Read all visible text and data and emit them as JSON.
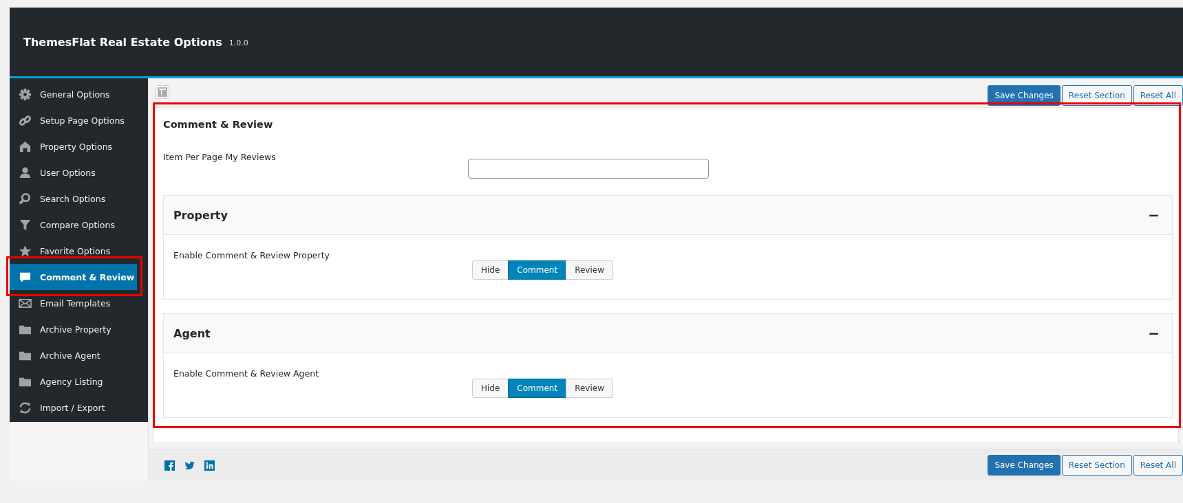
{
  "header": {
    "title": "ThemesFlat Real Estate Options",
    "version": "1.0.0"
  },
  "sidebar": {
    "items": [
      {
        "label": "General Options",
        "selected": false
      },
      {
        "label": "Setup Page Options",
        "selected": false
      },
      {
        "label": "Property Options",
        "selected": false
      },
      {
        "label": "User Options",
        "selected": false
      },
      {
        "label": "Search Options",
        "selected": false
      },
      {
        "label": "Compare Options",
        "selected": false
      },
      {
        "label": "Favorite Options",
        "selected": false
      },
      {
        "label": "Comment & Review",
        "selected": true
      },
      {
        "label": "Email Templates",
        "selected": false
      },
      {
        "label": "Archive Property",
        "selected": false
      },
      {
        "label": "Archive Agent",
        "selected": false
      },
      {
        "label": "Agency Listing",
        "selected": false
      },
      {
        "label": "Import / Export",
        "selected": false
      }
    ]
  },
  "toolbar": {
    "buttons": [
      {
        "label": "Save Changes",
        "kind": "primary"
      },
      {
        "label": "Reset Section",
        "kind": "secondary"
      },
      {
        "label": "Reset All",
        "kind": "secondary"
      }
    ]
  },
  "content": {
    "title": "Comment & Review",
    "field": {
      "label": "Item Per Page My Reviews"
    },
    "sections": [
      {
        "title": "Property",
        "collapse": "−",
        "label": "Enable Comment & Review Property",
        "options": [
          {
            "label": "Hide",
            "selected": false
          },
          {
            "label": "Comment",
            "selected": true
          },
          {
            "label": "Review",
            "selected": false
          }
        ]
      },
      {
        "title": "Agent",
        "collapse": "−",
        "label": "Enable Comment & Review Agent",
        "options": [
          {
            "label": "Hide",
            "selected": false
          },
          {
            "label": "Comment",
            "selected": true
          },
          {
            "label": "Review",
            "selected": false
          }
        ]
      }
    ]
  },
  "footer": {
    "buttons": [
      {
        "label": "Save Changes",
        "kind": "primary"
      },
      {
        "label": "Reset Section",
        "kind": "secondary"
      },
      {
        "label": "Reset All",
        "kind": "secondary"
      }
    ]
  }
}
